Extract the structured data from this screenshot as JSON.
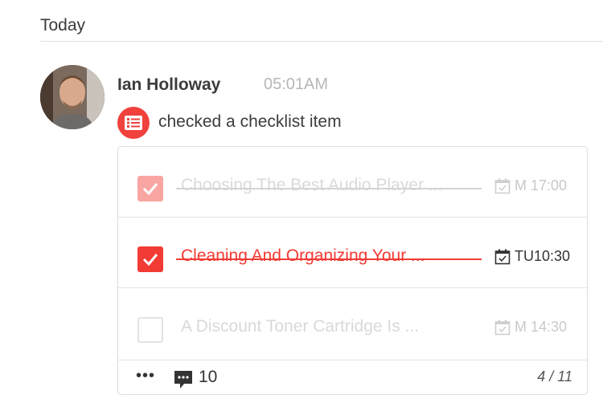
{
  "section": {
    "day_label": "Today"
  },
  "activity": {
    "user_name": "Ian Holloway",
    "time": "05:01AM",
    "action_text": "checked a checklist item",
    "accent_color": "#f0413c"
  },
  "checklist": {
    "items": [
      {
        "title": "Choosing The Best Audio Player ...",
        "due": "M 17:00",
        "checked": true,
        "state": "faded"
      },
      {
        "title": "Cleaning And Organizing Your ...",
        "due": "TU10:30",
        "checked": true,
        "state": "active"
      },
      {
        "title": "A Discount Toner Cartridge Is ...",
        "due": "M 14:30",
        "checked": false,
        "state": "faded"
      }
    ],
    "footer": {
      "more_label": "•••",
      "comment_count": "10",
      "progress": "4 / 11"
    }
  },
  "icons": {
    "activity": "checklist-icon",
    "due": "calendar-check-icon",
    "comments": "comment-bubble-icon"
  }
}
